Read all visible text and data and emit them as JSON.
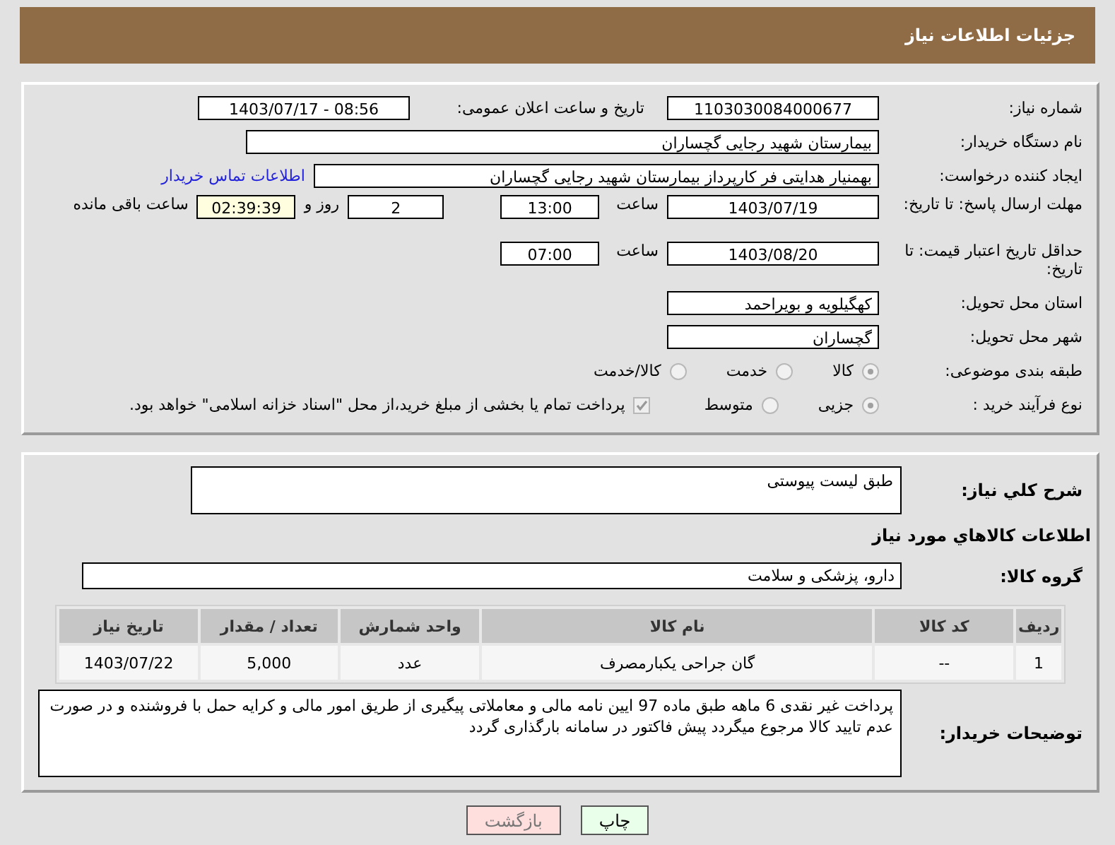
{
  "header": {
    "title": "جزئیات اطلاعات نیاز"
  },
  "need_number": {
    "label": "شماره نیاز:",
    "value": "1103030084000677"
  },
  "announce": {
    "label": "تاریخ و ساعت اعلان عمومی:",
    "value": "1403/07/17 - 08:56"
  },
  "buyer": {
    "label": "نام دستگاه خریدار:",
    "value": "بیمارستان شهید رجایی گچساران"
  },
  "requester": {
    "label": "ایجاد کننده درخواست:",
    "value": "بهمنیار هدایتی فر کارپرداز بیمارستان شهید رجایی گچساران",
    "link": "اطلاعات تماس خریدار"
  },
  "reply_deadline": {
    "label": "مهلت ارسال پاسخ: تا تاریخ:",
    "date": "1403/07/19",
    "time_label": "ساعت",
    "time": "13:00",
    "days": "2",
    "days_label": "روز و",
    "remaining": "02:39:39",
    "remaining_label": "ساعت باقی مانده"
  },
  "price_validity": {
    "label": "حداقل تاریخ اعتبار قیمت: تا تاریخ:",
    "date": "1403/08/20",
    "time_label": "ساعت",
    "time": "07:00"
  },
  "province": {
    "label": "استان محل تحویل:",
    "value": "کهگیلویه و بویراحمد"
  },
  "city": {
    "label": "شهر محل تحویل:",
    "value": "گچساران"
  },
  "category": {
    "label": "طبقه بندی موضوعی:",
    "options": [
      {
        "label": "کالا",
        "selected": true
      },
      {
        "label": "خدمت",
        "selected": false
      },
      {
        "label": "کالا/خدمت",
        "selected": false
      }
    ]
  },
  "process": {
    "label": "نوع فرآیند خرید :",
    "options": [
      {
        "label": "جزیی",
        "selected": true
      },
      {
        "label": "متوسط",
        "selected": false
      }
    ],
    "payment": {
      "label": "پرداخت تمام یا بخشی از مبلغ خرید،از محل \"اسناد خزانه اسلامی\" خواهد بود.",
      "checked": true
    }
  },
  "description": {
    "label": "شرح کلي نیاز:",
    "value": "طبق لیست پیوستی"
  },
  "goods_title": "اطلاعات کالاهاي مورد نیاز",
  "goods_group": {
    "label": "گروه کالا:",
    "value": "دارو، پزشکی و سلامت"
  },
  "table": {
    "columns": [
      "ردیف",
      "کد کالا",
      "نام کالا",
      "واحد شمارش",
      "تعداد / مقدار",
      "تاریخ نیاز"
    ],
    "rows": [
      [
        "1",
        "--",
        "گان جراحی یکبارمصرف",
        "عدد",
        "5,000",
        "1403/07/22"
      ]
    ]
  },
  "buyer_notes": {
    "label": "توضیحات خریدار:",
    "value": "پرداخت غیر نقدی 6 ماهه  طبق ماده 97 ایین نامه مالی و معاملاتی پیگیری از طریق امور مالی  و کرایه حمل با فروشنده و در صورت عدم تایید کالا مرجوع میگردد پیش فاکتور در سامانه بارگذاری گردد"
  },
  "buttons": [
    {
      "label": "چاپ",
      "kind": "print"
    },
    {
      "label": "بازگشت",
      "kind": "back"
    }
  ]
}
